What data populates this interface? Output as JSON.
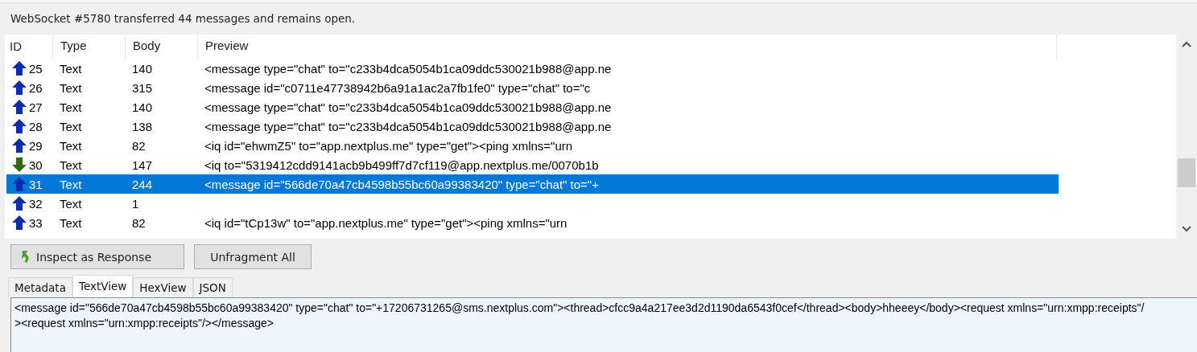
{
  "status_bar": "WebSocket #5780 transferred 44 messages and remains open.",
  "table": {
    "columns": [
      "ID",
      "Type",
      "Body",
      "Preview"
    ],
    "rows": [
      {
        "kind": "up",
        "id": "25",
        "type": "Text",
        "body": "140",
        "preview": "<message type=\"chat\" to=\"c233b4dca5054b1ca09ddc530021b988@app.ne",
        "selected": false
      },
      {
        "kind": "up",
        "id": "26",
        "type": "Text",
        "body": "315",
        "preview": "<message id=\"c0711e47738942b6a91a1ac2a7fb1fe0\" type=\"chat\" to=\"c",
        "selected": false
      },
      {
        "kind": "up",
        "id": "27",
        "type": "Text",
        "body": "140",
        "preview": "<message type=\"chat\" to=\"c233b4dca5054b1ca09ddc530021b988@app.ne",
        "selected": false
      },
      {
        "kind": "up",
        "id": "28",
        "type": "Text",
        "body": "138",
        "preview": "<message type=\"chat\" to=\"c233b4dca5054b1ca09ddc530021b988@app.ne",
        "selected": false
      },
      {
        "kind": "up",
        "id": "29",
        "type": "Text",
        "body": "82",
        "preview": "<iq id=\"ehwmZ5\" to=\"app.nextplus.me\" type=\"get\"><ping xmlns=\"urn",
        "selected": false
      },
      {
        "kind": "down",
        "id": "30",
        "type": "Text",
        "body": "147",
        "preview": "<iq to=\"5319412cdd9141acb9b499ff7d7cf119@app.nextplus.me/0070b1b",
        "selected": false
      },
      {
        "kind": "up",
        "id": "31",
        "type": "Text",
        "body": "244",
        "preview": "<message id=\"566de70a47cb4598b55bc60a99383420\" type=\"chat\" to=\"+",
        "selected": true
      },
      {
        "kind": "up",
        "id": "32",
        "type": "Text",
        "body": "1",
        "selected": false
      },
      {
        "kind": "up",
        "id": "33",
        "type": "Text",
        "body": "82",
        "preview": "<iq id=\"tCp13w\" to=\"app.nextplus.me\" type=\"get\"><ping xmlns=\"urn",
        "selected": false
      }
    ]
  },
  "buttons": [
    {
      "label": "Inspect as Response",
      "kind": "inspect"
    },
    {
      "label": "Unfragment All",
      "kind": "plain"
    }
  ],
  "tabs": [
    {
      "label": "Metadata",
      "selected": false
    },
    {
      "label": "TextView",
      "selected": true
    },
    {
      "label": "HexView",
      "selected": false
    },
    {
      "label": "JSON",
      "selected": false
    }
  ],
  "text_view": "<message id=\"566de70a47cb4598b55bc60a99383420\" type=\"chat\" to=\"+17206731265@sms.nextplus.com\"><thread>cfcc9a4a217ee3d2d1190da6543f0cef</thread><body>hheeey</body><request xmlns=\"urn:xmpp:receipts\"/><request xmlns=\"urn:xmpp:receipts\"/></message>"
}
